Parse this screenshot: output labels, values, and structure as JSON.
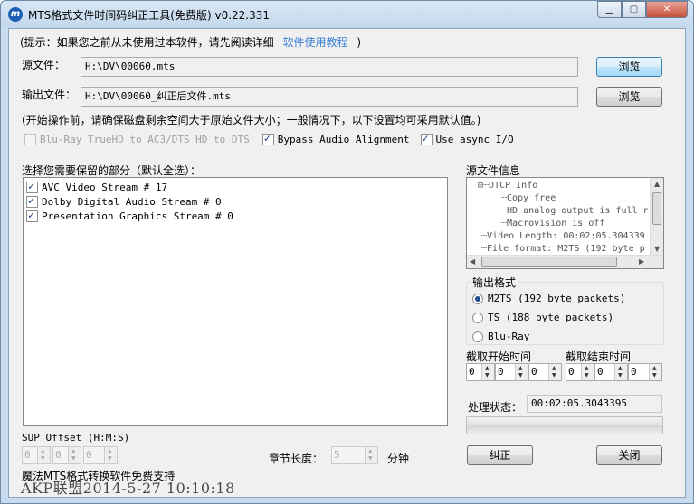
{
  "window": {
    "title": "MTS格式文件时间码纠正工具(免费版) v0.22.331",
    "app_icon": "m"
  },
  "tip": {
    "prefix": "(提示：如果您之前从未使用过本软件，请先阅读详细",
    "link": "软件使用教程",
    "suffix": ")"
  },
  "source": {
    "label": "源文件：",
    "value": "H:\\DV\\00060.mts",
    "browse": "浏览"
  },
  "output": {
    "label": "输出文件：",
    "value": "H:\\DV\\00060_纠正后文件.mts",
    "browse": "浏览"
  },
  "notice": "(开始操作前，请确保磁盘剩余空间大于原始文件大小；一般情况下，以下设置均可采用默认值。)",
  "options": {
    "bluray_audio": "Blu-Ray TrueHD to AC3/DTS HD to DTS",
    "bypass_audio": "Bypass Audio Alignment",
    "async_io": "Use async I/O"
  },
  "streams": {
    "label": "选择您需要保留的部分（默认全选）：",
    "items": [
      "AVC Video Stream # 17",
      "Dolby Digital Audio Stream # 0",
      "Presentation Graphics Stream # 0"
    ]
  },
  "source_info": {
    "label": "源文件信息",
    "lines": [
      "DTCP Info",
      "Copy free",
      "HD analog output is full r",
      "Macrovision is off",
      "Video Length: 00:02:05.304339",
      "File format: M2TS (192 byte p"
    ]
  },
  "output_format": {
    "label": "输出格式",
    "options": [
      "M2TS (192 byte packets)",
      "TS (188 byte packets)",
      "Blu-Ray"
    ],
    "selected": 0
  },
  "cut": {
    "start_label": "截取开始时间",
    "end_label": "截取结束时间",
    "start": [
      "0",
      "0",
      "0"
    ],
    "end": [
      "0",
      "0",
      "0"
    ]
  },
  "status": {
    "label": "处理状态：",
    "value": "00:02:05.3043395",
    "progress": 0
  },
  "sup": {
    "label": "SUP Offset (H:M:S)",
    "values": [
      "0",
      "0",
      "0"
    ]
  },
  "chapter": {
    "label": "章节长度：",
    "value": "5",
    "unit": "分钟"
  },
  "buttons": {
    "correct": "纠正",
    "close": "关闭"
  },
  "footer": "魔法MTS格式转换软件免费支持",
  "watermark": "AKP联盟2014-5-27  10:10:18"
}
